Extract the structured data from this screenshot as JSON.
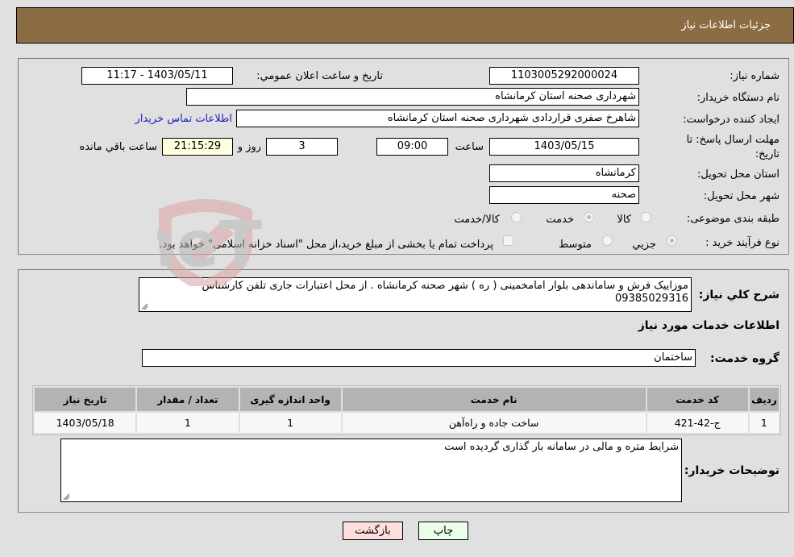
{
  "header": {
    "title": "جزئيات اطلاعات نياز"
  },
  "details": {
    "need_number": {
      "label": "شماره نیاز:",
      "value": "1103005292000024"
    },
    "announce_datetime": {
      "label": "تاريخ و ساعت اعلان عمومي:",
      "value": "1403/05/11 - 11:17"
    },
    "buyer_org": {
      "label": "نام دستگاه خریدار:",
      "value": "شهرداری صحنه استان کرمانشاه"
    },
    "requester": {
      "label": "ایجاد کننده درخواست:",
      "value": "شاهرخ صفری قراردادی شهرداری صحنه استان کرمانشاه"
    },
    "buyer_contact_link": "اطلاعات تماس خریدار",
    "deadline": {
      "label_line1": "مهلت ارسال پاسخ: تا",
      "label_line2": "تاریخ:",
      "date": "1403/05/15",
      "time_label": "ساعت",
      "time": "09:00",
      "days": "3",
      "days_label": "روز و",
      "remaining": "21:15:29",
      "remaining_label": "ساعت باقي مانده"
    },
    "delivery_province": {
      "label": "استان محل تحویل:",
      "value": "کرمانشاه"
    },
    "delivery_city": {
      "label": "شهر محل تحویل:",
      "value": "صحنه"
    },
    "category": {
      "label": "طبقه بندی موضوعی:",
      "options": [
        {
          "label": "کالا",
          "checked": false
        },
        {
          "label": "خدمت",
          "checked": true
        },
        {
          "label": "کالا/خدمت",
          "checked": false
        }
      ]
    },
    "purchase_type": {
      "label": "نوع فرآیند خرید :",
      "options": [
        {
          "label": "جزيي",
          "checked": true
        },
        {
          "label": "متوسط",
          "checked": false
        }
      ],
      "treasury_checkbox_label": "پرداخت تمام یا بخشی از مبلغ خرید،از محل \"اسناد خزانه اسلامی\" خواهد بود.",
      "treasury_checked": false
    }
  },
  "summary": {
    "label": "شرح كلي نياز:",
    "value": "موزاییک فرش و ساماندهی بلوار امامخمینی ( ره ) شهر صحنه  کرمانشاه . از محل اعتبارات جاری  تلفن کارشناس 09385029316"
  },
  "services_section_title": "اطلاعات خدمات مورد نياز",
  "service_group": {
    "label": "گروه خدمت:",
    "value": "ساختمان"
  },
  "services_table": {
    "headers": [
      "ردیف",
      "کد خدمت",
      "نام خدمت",
      "واحد اندازه گیری",
      "تعداد / مقدار",
      "تاریخ نیاز"
    ],
    "rows": [
      [
        "1",
        "ج-42-421",
        "ساخت جاده و راه‌آهن",
        "1",
        "1",
        "1403/05/18"
      ]
    ]
  },
  "buyer_notes": {
    "label": "توضیحات خریدار:",
    "value": "شرایط متره و مالی در سامانه بار گذاری گردیده است"
  },
  "buttons": {
    "print": "چاپ",
    "back": "بازگشت"
  },
  "watermark": {
    "text": "AriaTender.neT"
  },
  "colors": {
    "header_bg": "#8c6d43",
    "page_bg": "#e0e0e0",
    "link": "#2020c0",
    "print_btn": "#eaffea",
    "back_btn": "#ffdede"
  }
}
